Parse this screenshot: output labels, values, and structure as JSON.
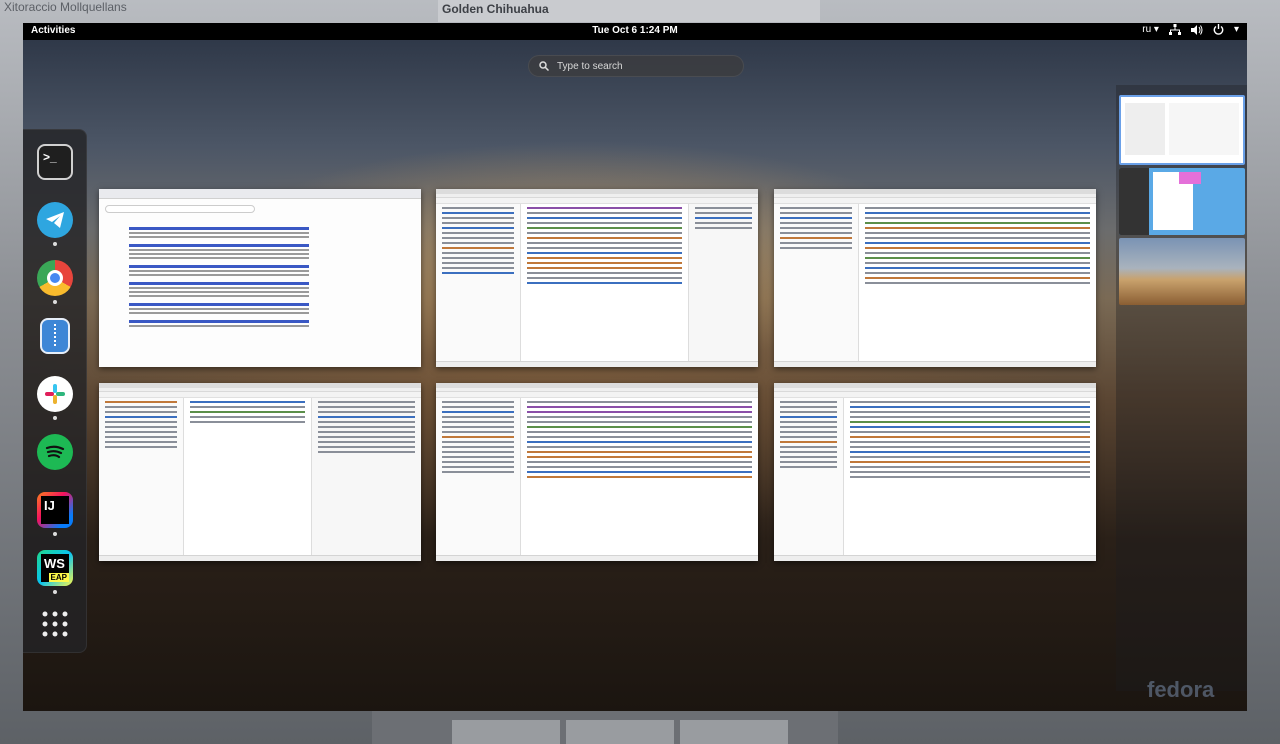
{
  "background_window": {
    "title_left": "Xitoraccio Mollquellans",
    "title_center": "Golden Chihuahua"
  },
  "topbar": {
    "activities": "Activities",
    "clock": "Tue Oct 6  1:24 PM",
    "keyboard_layout": "ru ▾",
    "system_menu_arrow": "▾"
  },
  "search": {
    "placeholder": "Type to search"
  },
  "dash": {
    "apps": [
      {
        "name": "terminal",
        "label": ">_"
      },
      {
        "name": "telegram",
        "label": ""
      },
      {
        "name": "chrome",
        "label": ""
      },
      {
        "name": "files",
        "label": ""
      },
      {
        "name": "slack",
        "label": ""
      },
      {
        "name": "spotify",
        "label": ""
      },
      {
        "name": "intellij",
        "label": "IJ"
      },
      {
        "name": "webstorm",
        "label": "WS",
        "badge": "EAP"
      }
    ],
    "show_apps_icon": "grid-icon"
  },
  "workspaces_count": 3,
  "watermark": "fedora",
  "colors": {
    "topbar": "#000000",
    "workspace_active_border": "#6aa0e8",
    "telegram": "#2ea6e0",
    "spotify": "#1db954"
  }
}
